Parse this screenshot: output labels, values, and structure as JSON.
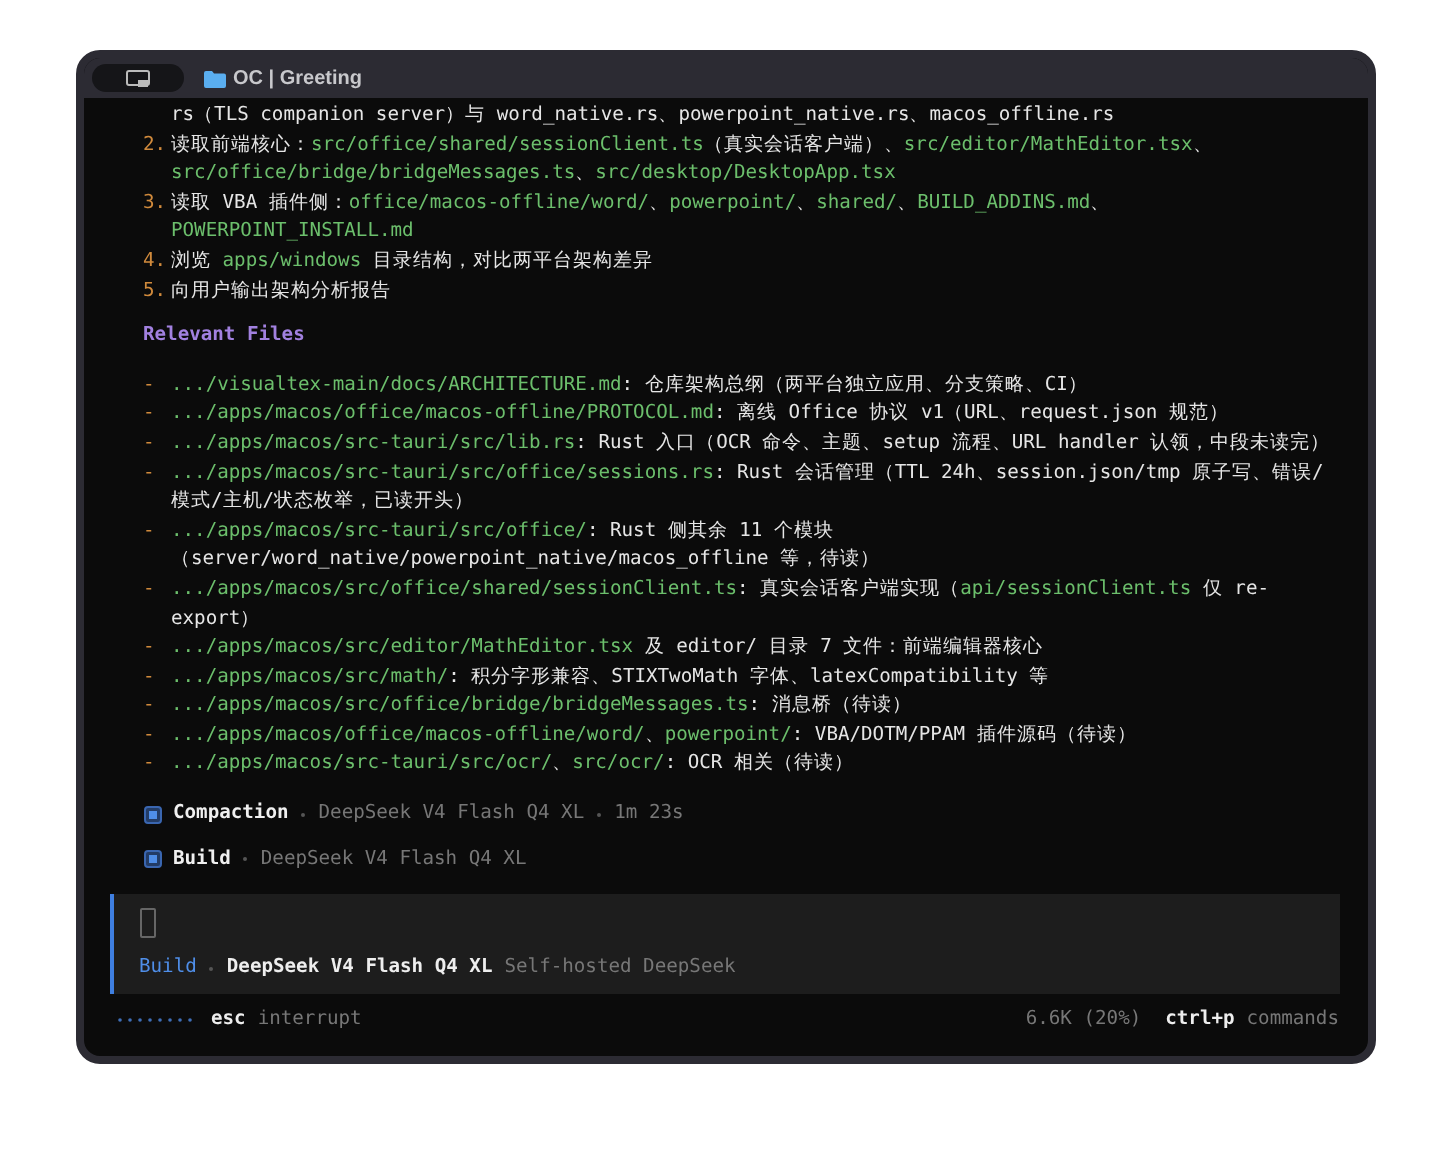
{
  "window": {
    "title": "OC | Greeting"
  },
  "plan_items": [
    {
      "kind": "continuation",
      "segments": [
        {
          "kind": "text",
          "text": "rs（TLS companion server）与 word_native.rs、powerpoint_native.rs、macos_offline.rs"
        }
      ]
    },
    {
      "kind": "numbered",
      "marker": "2.",
      "segments": [
        {
          "kind": "text",
          "text": "读取前端核心："
        },
        {
          "kind": "path",
          "text": "src/office/shared/sessionClient.ts"
        },
        {
          "kind": "text",
          "text": "（真实会话客户端）、"
        },
        {
          "kind": "path",
          "text": "src/editor/MathEditor.tsx"
        },
        {
          "kind": "text",
          "text": "、"
        },
        {
          "kind": "path",
          "text": "src/office/bridge/bridgeMessages.ts"
        },
        {
          "kind": "text",
          "text": "、"
        },
        {
          "kind": "path",
          "text": "src/desktop/DesktopApp.tsx"
        }
      ]
    },
    {
      "kind": "numbered",
      "marker": "3.",
      "segments": [
        {
          "kind": "text",
          "text": "读取 VBA 插件侧："
        },
        {
          "kind": "path",
          "text": "office/macos-offline/word/"
        },
        {
          "kind": "text",
          "text": "、"
        },
        {
          "kind": "path",
          "text": "powerpoint/"
        },
        {
          "kind": "text",
          "text": "、"
        },
        {
          "kind": "path",
          "text": "shared/"
        },
        {
          "kind": "text",
          "text": "、"
        },
        {
          "kind": "path",
          "text": "BUILD_ADDINS.md"
        },
        {
          "kind": "text",
          "text": "、"
        },
        {
          "kind": "path",
          "text": "POWERPOINT_INSTALL.md"
        }
      ]
    },
    {
      "kind": "numbered",
      "marker": "4.",
      "segments": [
        {
          "kind": "text",
          "text": "浏览 "
        },
        {
          "kind": "path",
          "text": "apps/windows"
        },
        {
          "kind": "text",
          "text": " 目录结构，对比两平台架构差异"
        }
      ]
    },
    {
      "kind": "numbered",
      "marker": "5.",
      "segments": [
        {
          "kind": "text",
          "text": "向用户输出架构分析报告"
        }
      ]
    }
  ],
  "relevant_files": {
    "heading": "Relevant Files",
    "items": [
      {
        "marker": "-",
        "segments": [
          {
            "kind": "path",
            "text": ".../visualtex-main/docs/ARCHITECTURE.md"
          },
          {
            "kind": "text",
            "text": ": 仓库架构总纲（两平台独立应用、分支策略、CI）"
          }
        ]
      },
      {
        "marker": "-",
        "segments": [
          {
            "kind": "path",
            "text": ".../apps/macos/office/macos-offline/PROTOCOL.md"
          },
          {
            "kind": "text",
            "text": ": 离线 Office 协议 v1（URL、request.json 规范）"
          }
        ]
      },
      {
        "marker": "-",
        "segments": [
          {
            "kind": "path",
            "text": ".../apps/macos/src-tauri/src/lib.rs"
          },
          {
            "kind": "text",
            "text": ": Rust 入口（OCR 命令、主题、setup 流程、URL handler 认领，中段未读完）"
          }
        ]
      },
      {
        "marker": "-",
        "segments": [
          {
            "kind": "path",
            "text": ".../apps/macos/src-tauri/src/office/sessions.rs"
          },
          {
            "kind": "text",
            "text": ": Rust 会话管理（TTL 24h、session.json/tmp 原子写、错误/模式/主机/状态枚举，已读开头）"
          }
        ]
      },
      {
        "marker": "-",
        "segments": [
          {
            "kind": "path",
            "text": ".../apps/macos/src-tauri/src/office/"
          },
          {
            "kind": "text",
            "text": ": Rust 侧其余 11 个模块（server/word_native/powerpoint_native/macos_offline 等，待读）"
          }
        ]
      },
      {
        "marker": "-",
        "segments": [
          {
            "kind": "path",
            "text": ".../apps/macos/src/office/shared/sessionClient.ts"
          },
          {
            "kind": "text",
            "text": ": 真实会话客户端实现（"
          },
          {
            "kind": "path",
            "text": "api/sessionClient.ts"
          },
          {
            "kind": "text",
            "text": " 仅 re-export）"
          }
        ]
      },
      {
        "marker": "-",
        "segments": [
          {
            "kind": "path",
            "text": ".../apps/macos/src/editor/MathEditor.tsx"
          },
          {
            "kind": "text",
            "text": " 及 editor/ 目录 7 文件：前端编辑器核心"
          }
        ]
      },
      {
        "marker": "-",
        "segments": [
          {
            "kind": "path",
            "text": ".../apps/macos/src/math/"
          },
          {
            "kind": "text",
            "text": ": 积分字形兼容、STIXTwoMath 字体、latexCompatibility 等"
          }
        ]
      },
      {
        "marker": "-",
        "segments": [
          {
            "kind": "path",
            "text": ".../apps/macos/src/office/bridge/bridgeMessages.ts"
          },
          {
            "kind": "text",
            "text": ": 消息桥（待读）"
          }
        ]
      },
      {
        "marker": "-",
        "segments": [
          {
            "kind": "path",
            "text": ".../apps/macos/office/macos-offline/word/"
          },
          {
            "kind": "text",
            "text": "、"
          },
          {
            "kind": "path",
            "text": "powerpoint/"
          },
          {
            "kind": "text",
            "text": ": VBA/DOTM/PPAM 插件源码（待读）"
          }
        ]
      },
      {
        "marker": "-",
        "segments": [
          {
            "kind": "path",
            "text": ".../apps/macos/src-tauri/src/ocr/"
          },
          {
            "kind": "text",
            "text": "、"
          },
          {
            "kind": "path",
            "text": "src/ocr/"
          },
          {
            "kind": "text",
            "text": ": OCR 相关（待读）"
          }
        ]
      }
    ]
  },
  "tasks": [
    {
      "title": "Compaction",
      "details": [
        "DeepSeek V4 Flash Q4 XL",
        "1m 23s"
      ]
    },
    {
      "title": "Build",
      "details": [
        "DeepSeek V4 Flash Q4 XL"
      ]
    }
  ],
  "prompt": {
    "agent": "Build",
    "model": "DeepSeek V4 Flash Q4 XL",
    "provider": "Self-hosted DeepSeek"
  },
  "status_bar": {
    "key": "esc",
    "action": "interrupt",
    "usage": "6.6K (20%)",
    "shortcut_key": "ctrl+p",
    "shortcut_action": "commands"
  }
}
